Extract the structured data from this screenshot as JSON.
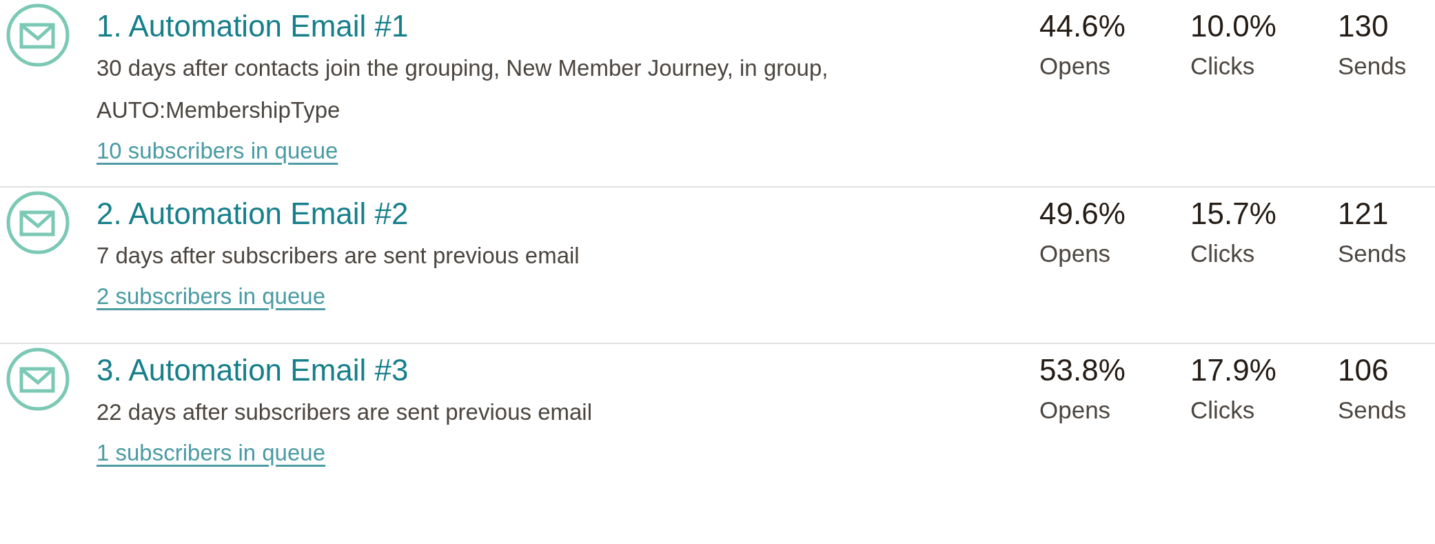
{
  "emails": [
    {
      "title": "1. Automation Email #1",
      "description": "30 days after contacts join the grouping, New Member Journey, in group, AUTO:MembershipType",
      "queue_link": "10 subscribers in queue",
      "stats": [
        {
          "value": "44.6%",
          "label": "Opens"
        },
        {
          "value": "10.0%",
          "label": "Clicks"
        },
        {
          "value": "130",
          "label": "Sends"
        }
      ]
    },
    {
      "title": "2. Automation Email #2",
      "description": "7 days after subscribers are sent previous email",
      "queue_link": "2 subscribers in queue",
      "stats": [
        {
          "value": "49.6%",
          "label": "Opens"
        },
        {
          "value": "15.7%",
          "label": "Clicks"
        },
        {
          "value": "121",
          "label": "Sends"
        }
      ]
    },
    {
      "title": "3. Automation Email #3",
      "description": "22 days after subscribers are sent previous email",
      "queue_link": "1 subscribers in queue",
      "stats": [
        {
          "value": "53.8%",
          "label": "Opens"
        },
        {
          "value": "17.9%",
          "label": "Clicks"
        },
        {
          "value": "106",
          "label": "Sends"
        }
      ]
    }
  ]
}
